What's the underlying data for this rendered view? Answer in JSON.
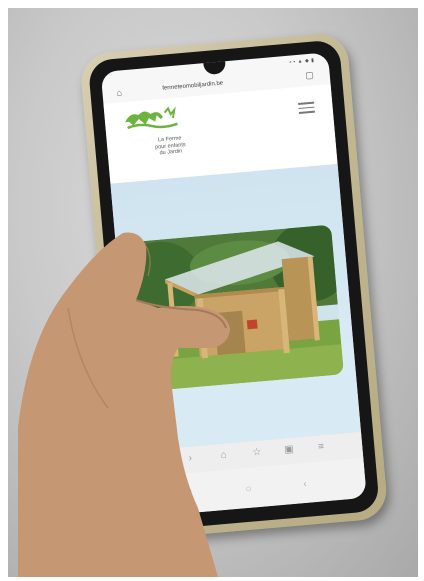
{
  "browser": {
    "url": "fermeteomobiljardin.be",
    "status_icons": "▪ ▪ ▲ ◆ ▮"
  },
  "site": {
    "logo_caption_line1": "La Ferme",
    "logo_caption_line2": "pour enfants",
    "logo_caption_line3": "du Jardin"
  },
  "colors": {
    "screen_background": "#d7e9f2",
    "logo_green": "#6db33f",
    "case_color": "#c2b893"
  },
  "icons": {
    "home": "home-icon",
    "tabs": "tabs-icon",
    "menu": "hamburger-menu-icon",
    "back": "chevron-left-icon",
    "forward": "chevron-right-icon",
    "share": "share-icon",
    "bookmark": "bookmark-icon",
    "tabs_switcher": "tabs-switcher-icon"
  }
}
